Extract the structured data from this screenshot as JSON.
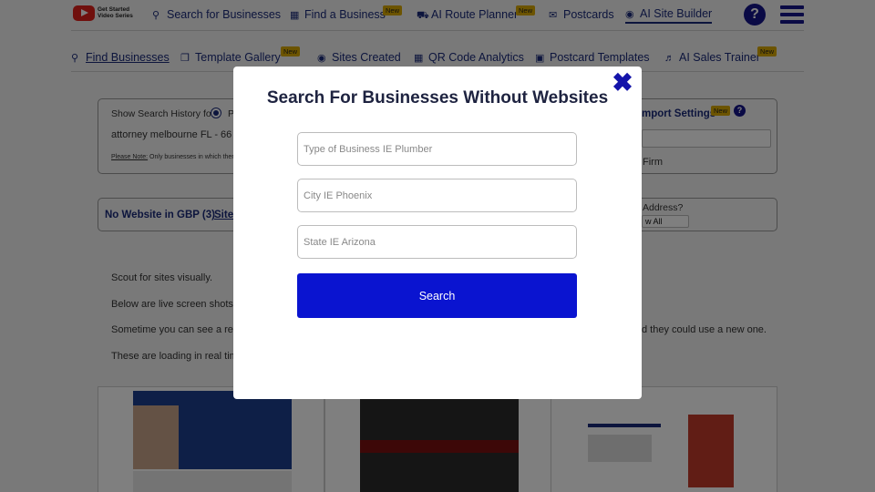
{
  "top_nav": {
    "logo_text": "Get Started Video Series",
    "items": [
      {
        "label": "Search for Businesses",
        "icon": "search-icon"
      },
      {
        "label": "Find a Business",
        "icon": "building-icon",
        "badge": "New"
      },
      {
        "label": "AI Route Planner",
        "icon": "car-icon",
        "badge": "New"
      },
      {
        "label": "Postcards",
        "icon": "envelope-icon"
      },
      {
        "label": "AI Site Builder",
        "icon": "globe-icon"
      }
    ],
    "help_label": "?"
  },
  "sub_nav": {
    "items": [
      {
        "label": "Find Businesses",
        "icon": "search-icon"
      },
      {
        "label": "Template Gallery",
        "icon": "copy-icon",
        "badge": "New"
      },
      {
        "label": "Sites Created",
        "icon": "globe-icon"
      },
      {
        "label": "QR Code Analytics",
        "icon": "qr-code-icon"
      },
      {
        "label": "Postcard Templates",
        "icon": "card-icon"
      },
      {
        "label": "AI Sales Trainer",
        "icon": "speaker-icon",
        "badge": "New"
      }
    ]
  },
  "background": {
    "history_label": "Show Search History for:",
    "history_radio_letter": "P",
    "history_value": "attorney melbourne FL - 66",
    "note_label": "Please Note:",
    "note_text": "Only businesses in which ther",
    "import_settings": "mport Settings",
    "import_badge": "New",
    "firm_text": "Firm",
    "tab_no_website": "No Website in GBP (3)",
    "tab_site": "Site",
    "address_label": "Address?",
    "address_select": "w All",
    "paragraphs": [
      "Scout for sites visually.",
      "Below are live screen shots",
      "Sometime you can see a rea",
      "d they could use a new one.",
      "These are loading in real tim"
    ]
  },
  "modal": {
    "title": "Search For Businesses Without Websites",
    "close_label": "✖",
    "fields": [
      {
        "placeholder": "Type of Business IE Plumber",
        "value": ""
      },
      {
        "placeholder": "City IE Phoenix",
        "value": ""
      },
      {
        "placeholder": "State IE Arizona",
        "value": ""
      }
    ],
    "search_button": "Search"
  },
  "colors": {
    "nav_text": "#1a2a7a",
    "badge": "#d9a800",
    "search_button": "#0a14d0",
    "close_icon": "#1414aa"
  }
}
